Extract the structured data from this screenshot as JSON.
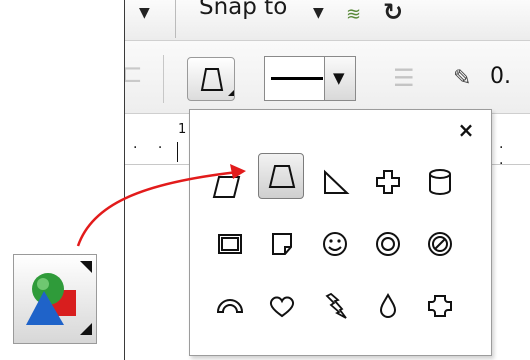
{
  "toolbar_top": {
    "snap_label": "Snap to"
  },
  "toolbar_property": {
    "outline_width_value": "0."
  },
  "ruler": {
    "tick_label": "1"
  },
  "popup": {
    "close_label": "×",
    "rows": [
      [
        "parallelogram",
        "trapezoid",
        "right-triangle",
        "cross",
        "cylinder"
      ],
      [
        "frame",
        "folded-corner",
        "smiley",
        "donut",
        "no-symbol"
      ],
      [
        "arch",
        "heart",
        "lightning",
        "teardrop",
        "octagon-plus"
      ]
    ],
    "selected": "trapezoid"
  },
  "colors": {
    "callout_arrow": "#e21b1b",
    "selected_bg": "#d9d9d9"
  },
  "icons": {
    "tool_icon": "perfect-shapes-tool-icon"
  }
}
